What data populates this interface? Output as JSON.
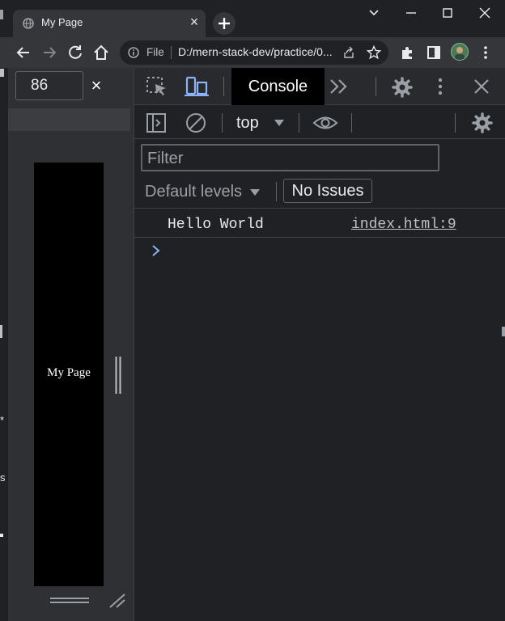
{
  "browser": {
    "tab": {
      "title": "My Page",
      "favicon": "globe-icon",
      "close": "×"
    },
    "omnibox": {
      "scheme_label": "File",
      "url": "D:/mern-stack-dev/practice/0..."
    },
    "colors": {
      "frame": "#202124",
      "toolbar": "#35363a"
    }
  },
  "device_toolbar": {
    "zoom_value": "86",
    "close": "×"
  },
  "viewport": {
    "page_text": "My Page",
    "edge_fragments": [
      "*",
      "s"
    ]
  },
  "devtools": {
    "tabs": {
      "active": "Console"
    },
    "console_toolbar": {
      "context": "top",
      "filter_placeholder": "Filter",
      "levels_label": "Default levels",
      "issues_label": "No Issues"
    },
    "messages": [
      {
        "text": "Hello World",
        "source": "index.html:9"
      }
    ],
    "colors": {
      "accent": "#8ab4f8",
      "panel": "#202124"
    }
  }
}
